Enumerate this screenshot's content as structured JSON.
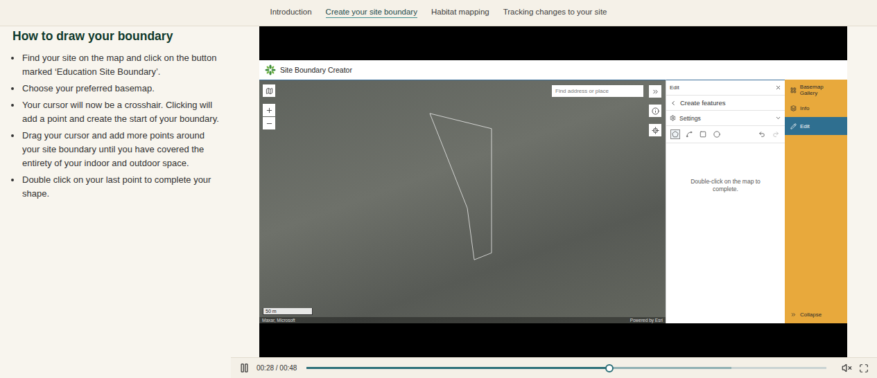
{
  "nav": {
    "tabs": [
      {
        "label": "Introduction",
        "selected": false
      },
      {
        "label": "Create your site boundary",
        "selected": true
      },
      {
        "label": "Habitat mapping",
        "selected": false
      },
      {
        "label": "Tracking changes to your site",
        "selected": false
      }
    ]
  },
  "instructions": {
    "title": "How to draw your boundary",
    "steps": [
      "Find your site on the map and click on the button marked ‘Education Site Boundary’.",
      "Choose your preferred basemap.",
      "Your cursor will now be a crosshair. Clicking will add a point and create the start of your boundary.",
      "Drag your cursor and add more points around your site boundary until you have covered the entirety of your indoor and outdoor space.",
      "Double click on your last point to complete your shape."
    ]
  },
  "video": {
    "app": {
      "title": "Site Boundary Creator",
      "map": {
        "search_placeholder": "Find address or place",
        "scale": "50 m",
        "attribution": "Maxar, Microsoft",
        "powered_by": "Powered by Esri"
      },
      "edit_panel": {
        "title": "Edit",
        "subtitle": "Create features",
        "settings": "Settings",
        "message": "Double-click on the map to complete."
      },
      "sidebar": {
        "items": [
          {
            "label": "Basemap Gallery",
            "selected": false
          },
          {
            "label": "Info",
            "selected": false
          },
          {
            "label": "Edit",
            "selected": true
          }
        ],
        "collapse": "Collapse"
      }
    },
    "controls": {
      "playing": true,
      "time": "00:28 / 00:48",
      "level": 0.583,
      "buffered": 0.817,
      "muted": true
    }
  }
}
